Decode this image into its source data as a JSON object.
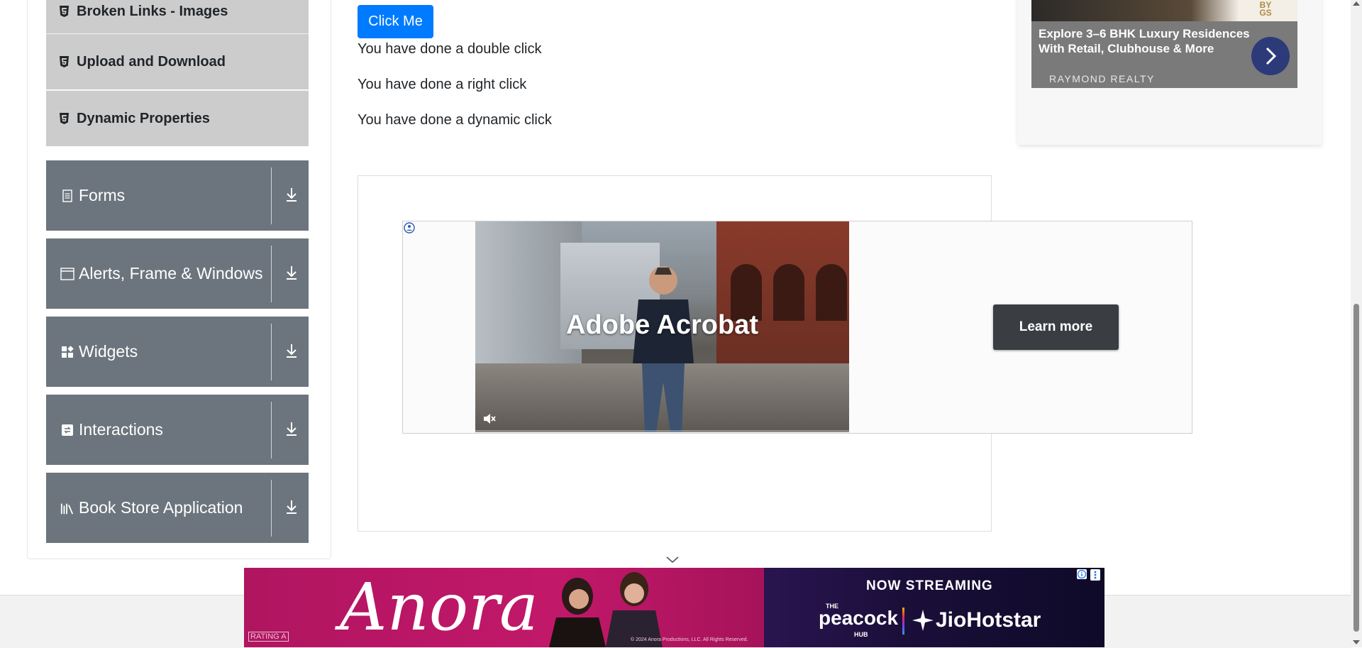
{
  "sidebar": {
    "elements_subitems": [
      {
        "label": "Broken Links - Images",
        "icon": "html5-icon"
      },
      {
        "label": "Upload and Download",
        "icon": "html5-icon"
      },
      {
        "label": "Dynamic Properties",
        "icon": "html5-icon"
      }
    ],
    "groups": [
      {
        "label": "Forms",
        "icon": "document-icon"
      },
      {
        "label": "Alerts, Frame & Windows",
        "icon": "window-icon"
      },
      {
        "label": "Widgets",
        "icon": "widgets-icon"
      },
      {
        "label": "Interactions",
        "icon": "interactions-icon"
      },
      {
        "label": "Book Store Application",
        "icon": "books-icon"
      }
    ]
  },
  "main": {
    "click_me_label": "Click Me",
    "messages": [
      "You have done a double click",
      "You have done a right click",
      "You have done a dynamic click"
    ]
  },
  "center_ad": {
    "video_title": "Adobe Acrobat",
    "cta_label": "Learn more"
  },
  "right_ad": {
    "by_label": "BY\nGS",
    "headline": "Explore 3–6 BHK Luxury Residences With Retail, Clubhouse & More",
    "brand": "RAYMOND REALTY"
  },
  "bottom_ad": {
    "movie_title": "Anora",
    "rating": "RATING A",
    "legal": "© 2024 Anora Productions, LLC. All Rights Reserved.",
    "streaming": "NOW STREAMING",
    "peacock_the": "THE",
    "peacock": "peacock",
    "peacock_hub": "HUB",
    "jiohotstar": "JioHotstar"
  },
  "colors": {
    "primary_button": "#007bff",
    "sidebar_group": "#6c757d",
    "sidebar_subitem": "#cccccc"
  }
}
